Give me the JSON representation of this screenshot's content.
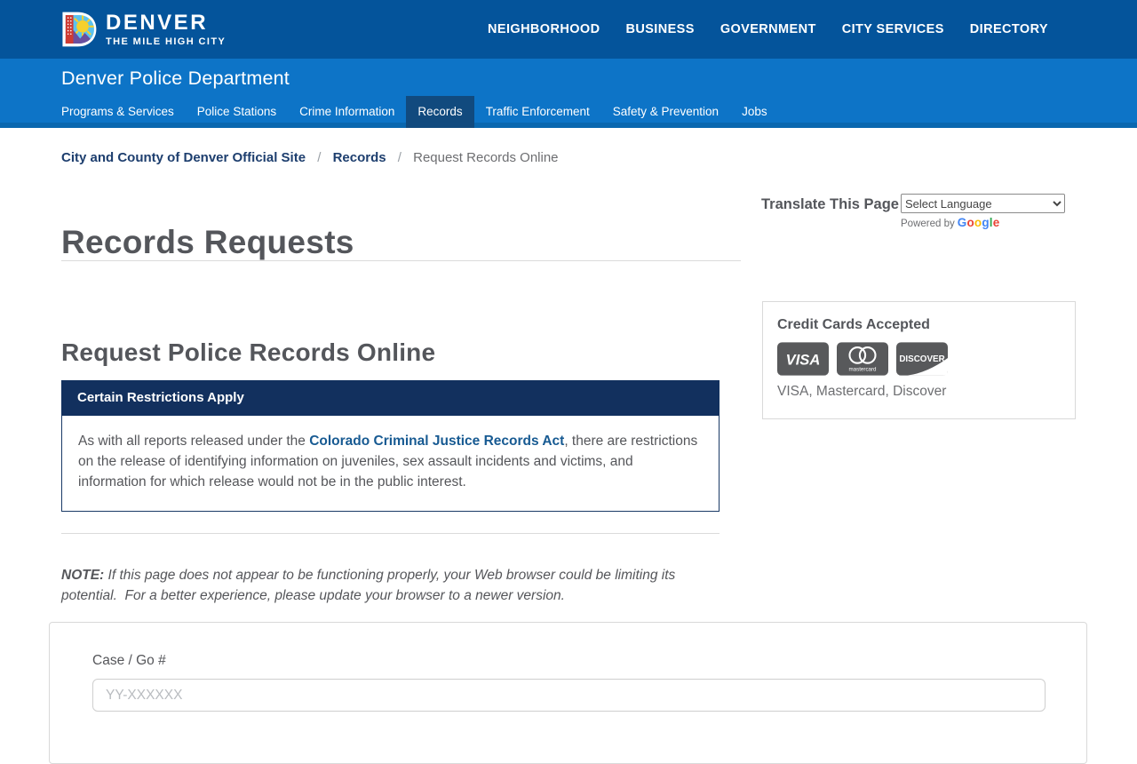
{
  "brand": {
    "name": "DENVER",
    "tagline": "THE MILE HIGH CITY"
  },
  "top_nav": {
    "items": [
      "NEIGHBORHOOD",
      "BUSINESS",
      "GOVERNMENT",
      "CITY SERVICES",
      "DIRECTORY"
    ]
  },
  "dept_header": {
    "title": "Denver Police Department",
    "nav": [
      {
        "label": "Programs & Services",
        "active": false
      },
      {
        "label": "Police Stations",
        "active": false
      },
      {
        "label": "Crime Information",
        "active": false
      },
      {
        "label": "Records",
        "active": true
      },
      {
        "label": "Traffic Enforcement",
        "active": false
      },
      {
        "label": "Safety & Prevention",
        "active": false
      },
      {
        "label": "Jobs",
        "active": false
      }
    ]
  },
  "breadcrumb": {
    "separator": "/",
    "items": [
      {
        "label": "City and County of Denver Official Site"
      },
      {
        "label": "Records"
      },
      {
        "label": "Request Records Online"
      }
    ]
  },
  "page": {
    "title": "Records Requests"
  },
  "translate": {
    "label": "Translate This Page",
    "select_value": "Select Language",
    "powered_by": "Powered by",
    "google_word": [
      "G",
      "o",
      "o",
      "g",
      "l",
      "e"
    ]
  },
  "credit_cards": {
    "title": "Credit Cards Accepted",
    "icons": [
      "visa-icon",
      "mastercard-icon",
      "discover-icon"
    ],
    "visa_label": "VISA",
    "mastercard_label": "mastercard",
    "discover_label": "DISCOVER",
    "list": "VISA, Mastercard, Discover"
  },
  "content": {
    "heading": "Request Police Records Online",
    "alert": {
      "title": "Certain Restrictions Apply",
      "body_prefix": "As with all reports released under the ",
      "link_text": "Colorado Criminal Justice Records Act",
      "body_suffix": ", there are restrictions on the release of identifying information on juveniles, sex assault incidents and victims, and information for which release would not be in the public interest."
    },
    "note": {
      "label": "NOTE:",
      "text": " If this page does not appear to be functioning properly, your Web browser could be limiting its potential.  For a better experience, please update your browser to a newer version."
    }
  },
  "form": {
    "case_label": "Case / Go #",
    "case_placeholder": "YY-XXXXXX"
  },
  "colors": {
    "topbar_blue": "#04549B",
    "band_blue": "#0D74C7",
    "band_strip_blue": "#0A67AF",
    "active_tab_navy": "#114A7E",
    "alert_navy": "#12305E",
    "link_blue": "#175A92",
    "breadcrumb_navy": "#1D3E6E",
    "heading_gray": "#54565B",
    "body_gray": "#55565A",
    "muted_gray": "#6D6E71",
    "card_gray": "#58595B",
    "google_blue": "#4285F4",
    "google_red": "#EA4335",
    "google_yellow": "#FBBC05",
    "google_green": "#34A853"
  }
}
